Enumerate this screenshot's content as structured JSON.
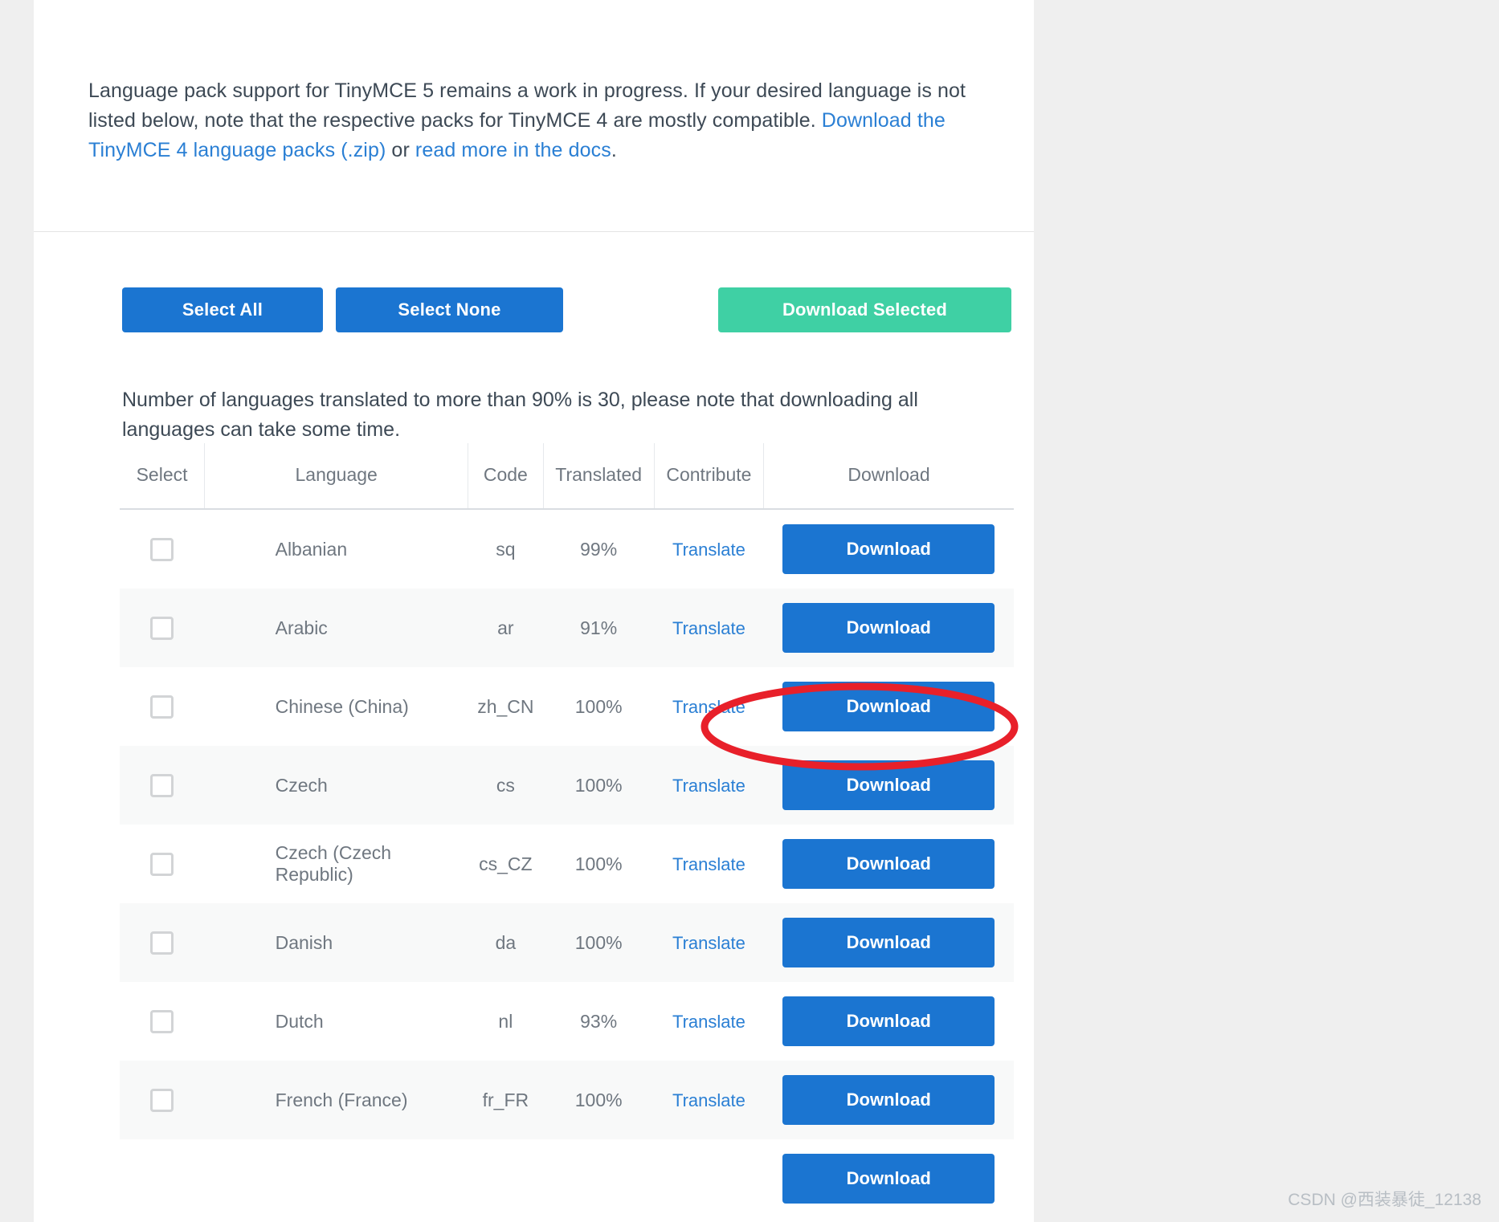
{
  "intro": {
    "text_part1": "Language pack support for TinyMCE 5 remains a work in progress. If your desired language is not listed below, note that the respective packs for TinyMCE 4 are mostly compatible. ",
    "link1": "Download the TinyMCE 4 language packs (.zip)",
    "text_part2": " or ",
    "link2": "read more in the docs",
    "text_part3": "."
  },
  "actions": {
    "select_all": "Select All",
    "select_none": "Select None",
    "download_selected": "Download Selected"
  },
  "note": "Number of languages translated to more than 90% is 30, please note that downloading all languages can take some time.",
  "table": {
    "headers": {
      "select": "Select",
      "language": "Language",
      "code": "Code",
      "translated": "Translated",
      "contribute": "Contribute",
      "download": "Download"
    },
    "translate_label": "Translate",
    "download_label": "Download",
    "rows": [
      {
        "language": "Albanian",
        "code": "sq",
        "translated": "99%"
      },
      {
        "language": "Arabic",
        "code": "ar",
        "translated": "91%"
      },
      {
        "language": "Chinese (China)",
        "code": "zh_CN",
        "translated": "100%"
      },
      {
        "language": "Czech",
        "code": "cs",
        "translated": "100%"
      },
      {
        "language": "Czech (Czech Republic)",
        "code": "cs_CZ",
        "translated": "100%"
      },
      {
        "language": "Danish",
        "code": "da",
        "translated": "100%"
      },
      {
        "language": "Dutch",
        "code": "nl",
        "translated": "93%"
      },
      {
        "language": "French (France)",
        "code": "fr_FR",
        "translated": "100%"
      }
    ]
  },
  "annotation": {
    "target_row_language": "Chinese (China)",
    "shape": "ellipse",
    "color": "#e8202a"
  },
  "watermark": "CSDN @西装暴徒_12138",
  "colors": {
    "primary_blue": "#1b75d1",
    "accent_green": "#3fd0a4",
    "link_blue": "#2a7fd4",
    "text_gray": "#6f7780",
    "page_background": "#efefef",
    "sheet_background": "#ffffff"
  }
}
